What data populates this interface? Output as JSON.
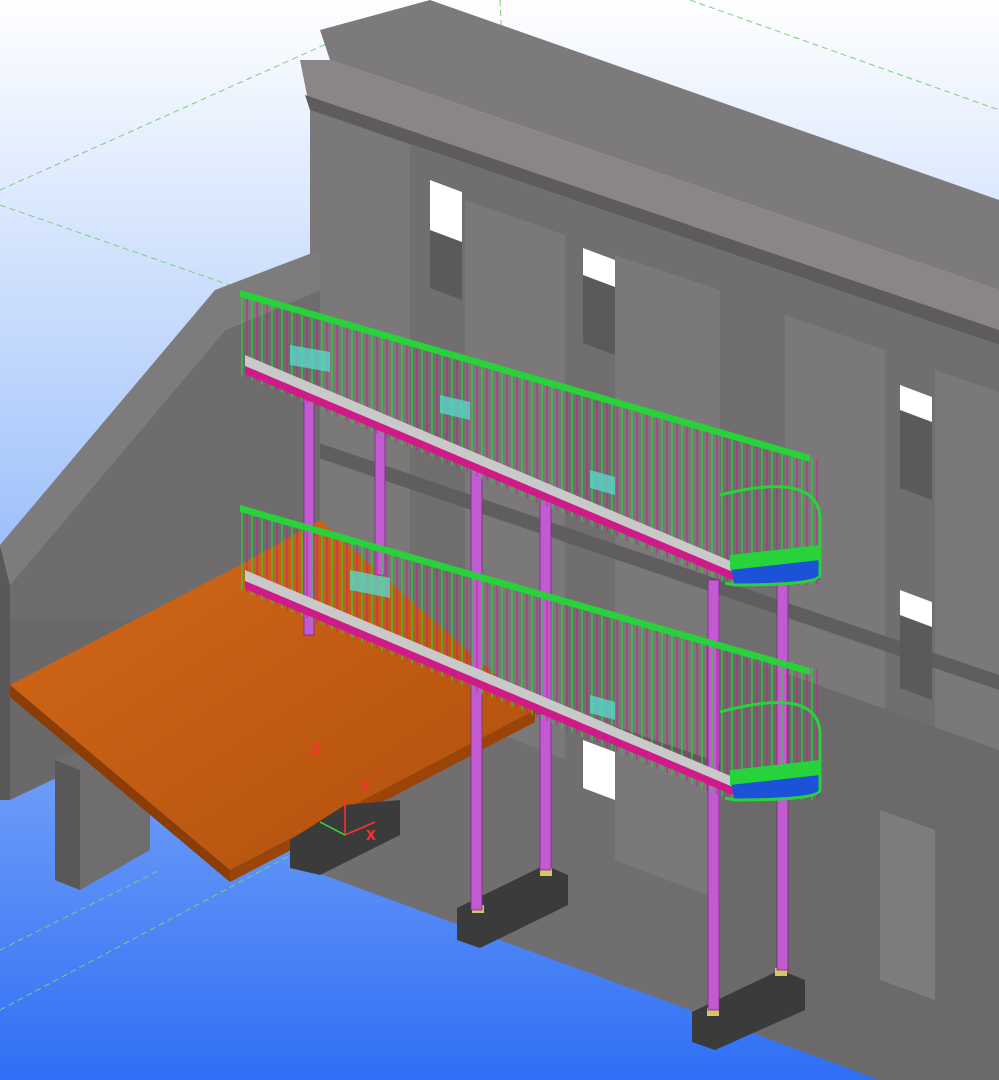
{
  "viewport": {
    "background_top": "#ffffff",
    "background_bottom": "#2f6ff5",
    "grid_color": "#7fd27f"
  },
  "model": {
    "wall_color": "#6f6d6e",
    "cornice_color": "#7f7a7c",
    "slab_color": "#c85f12",
    "column_color": "#c05ad0",
    "railing_green": "#27d23a",
    "railing_magenta": "#d01a8a",
    "footing_color": "#3a3a3a",
    "glass_color": "#5ad6c8"
  },
  "axes": {
    "z_label": "Z",
    "y_label": "Y",
    "x_label": "X"
  }
}
